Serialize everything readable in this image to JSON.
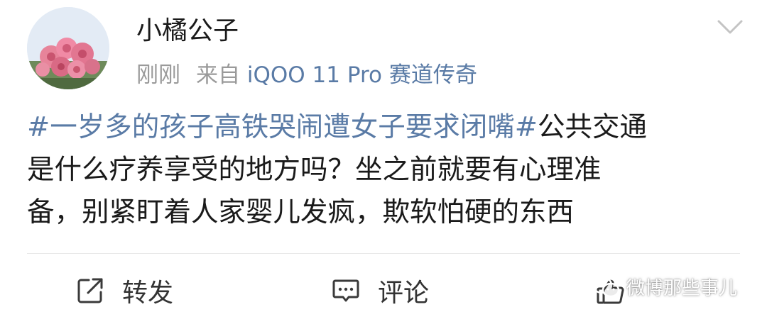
{
  "post": {
    "username": "小橘公子",
    "time": "刚刚",
    "source_prefix": "来自",
    "device": "iQOO 11 Pro 赛道传奇",
    "content": {
      "topic": "#一岁多的孩子高铁哭闹遭女子要求闭嘴#",
      "line1_rest": "公共交通",
      "line2": "是什么疗养享受的地方吗？坐之前就要有心理准",
      "line3": "备，别紧盯着人家婴儿发疯，欺软怕硬的东西"
    }
  },
  "actions": {
    "repost_label": "转发",
    "comment_label": "评论"
  },
  "watermark": {
    "text": "微博那些事儿"
  },
  "icons": {
    "avatar": "pink-roses-avatar",
    "more": "chevron-down-icon",
    "repost": "share-arrow-icon",
    "comment": "comment-bubble-icon",
    "like": "thumbs-up-icon",
    "watermark": "wechat-icon"
  },
  "colors": {
    "link": "#5a7ba6",
    "meta": "#9a9a9a",
    "text": "#1a1a1a"
  }
}
